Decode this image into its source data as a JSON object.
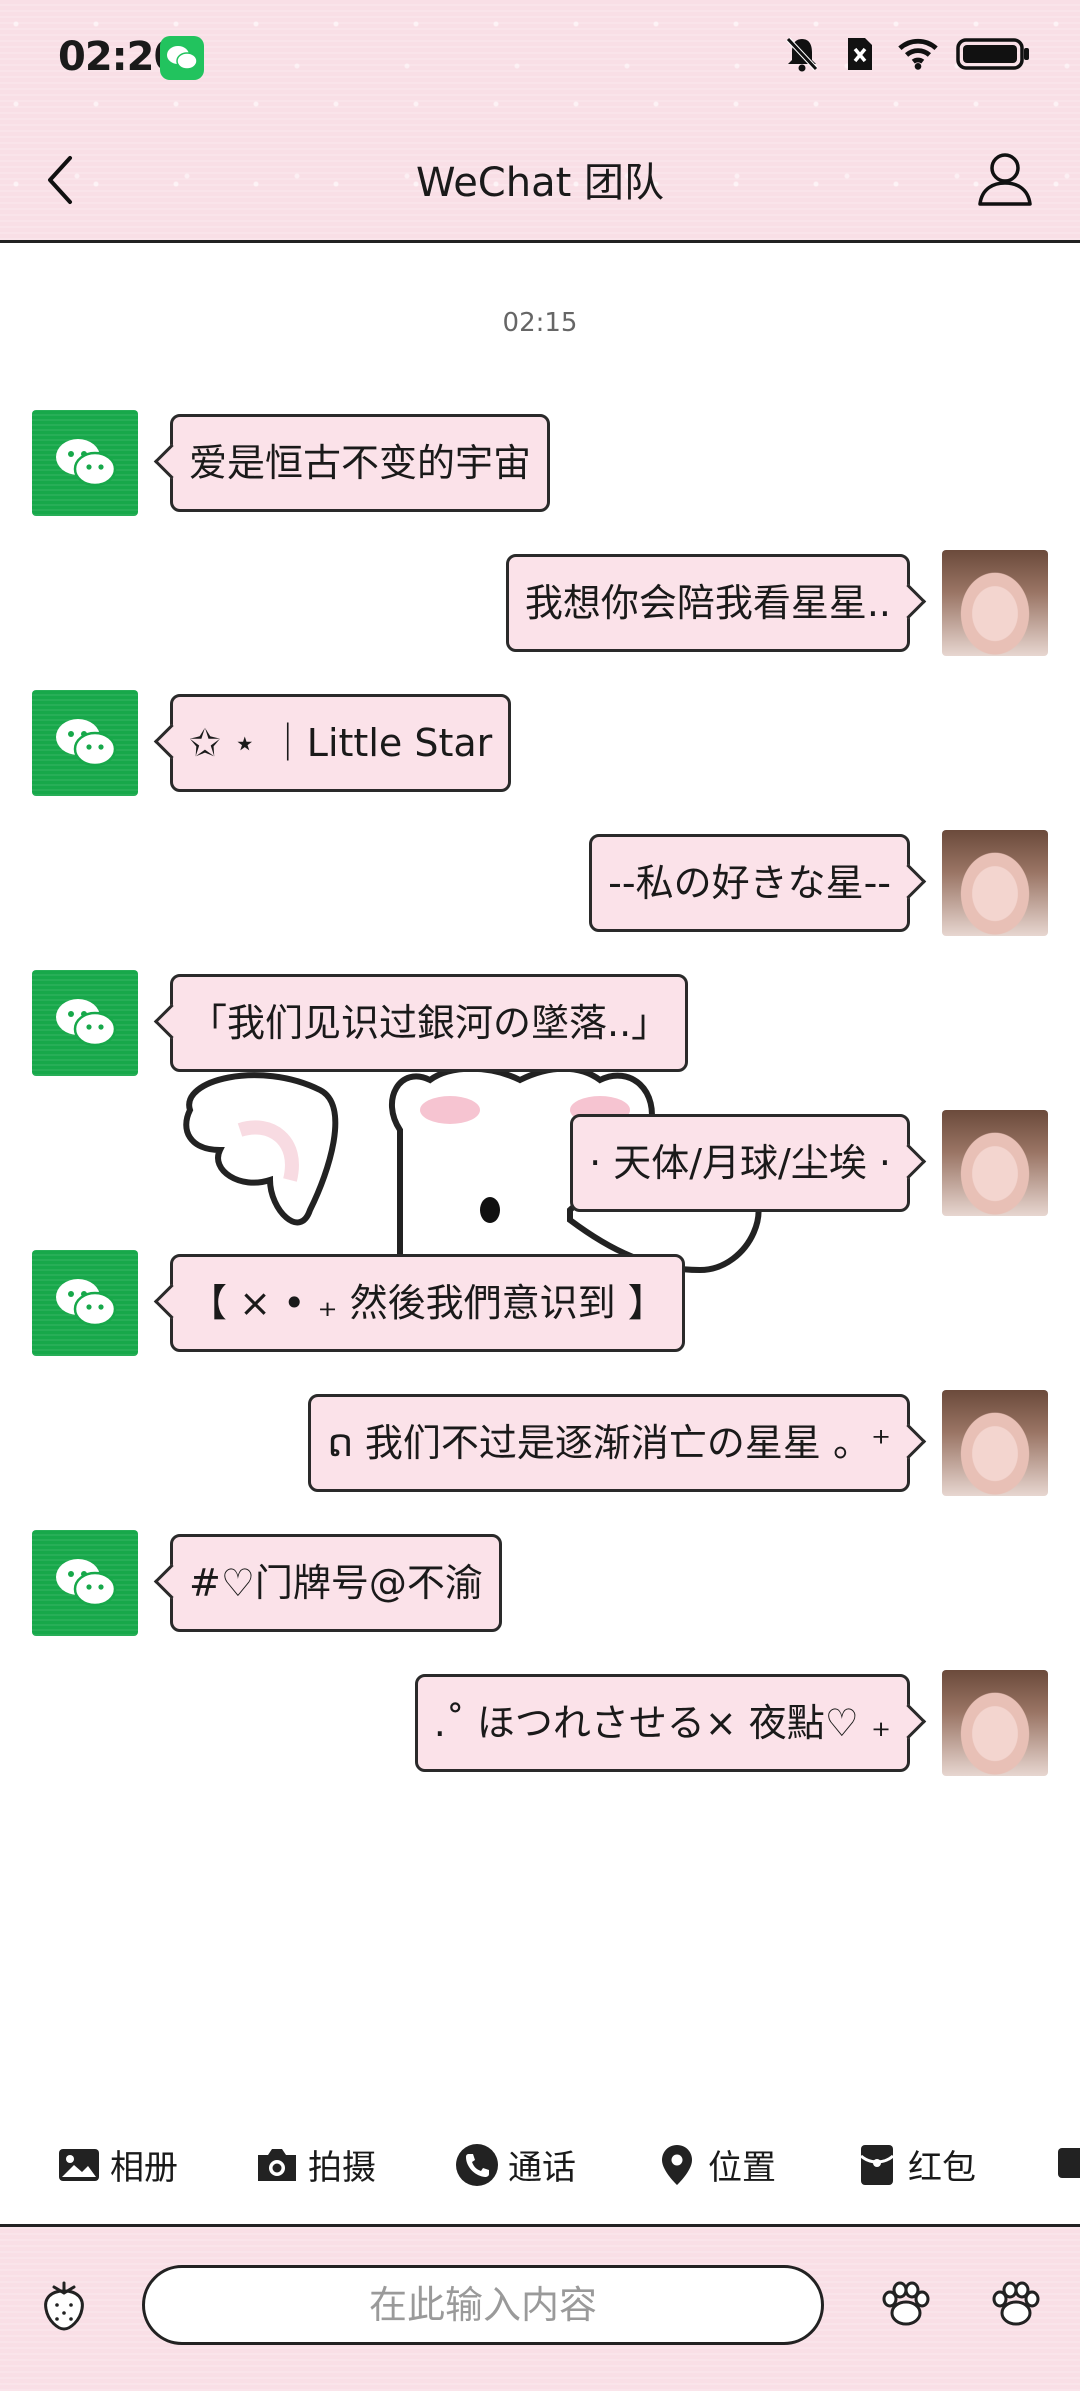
{
  "status_bar": {
    "time": "02:20"
  },
  "header": {
    "title": "WeChat 团队"
  },
  "chat": {
    "timestamp": "02:15",
    "messages": [
      {
        "side": "left",
        "text": "爱是恒古不变的宇宙"
      },
      {
        "side": "right",
        "text": "我想你会陪我看星星.."
      },
      {
        "side": "left",
        "text": "✩ ⋆ ｜Little Star"
      },
      {
        "side": "right",
        "text": "--私の好きな星--"
      },
      {
        "side": "left",
        "text": "「我们见识过銀河の墜落..」"
      },
      {
        "side": "right",
        "text": "· 天体/月球/尘埃 ·"
      },
      {
        "side": "left",
        "text": "【 ⨯ • ₊ 然後我們意识到 】"
      },
      {
        "side": "right",
        "text": "ດ 我们不过是逐渐消亡の星星 。⁺"
      },
      {
        "side": "left",
        "text": "#♡门牌号@不渝"
      },
      {
        "side": "right",
        "text": ".˚ ほつれさせる× 夜點♡ ₊"
      }
    ]
  },
  "toolbar": {
    "items": [
      {
        "label": "相册",
        "icon": "photo-album-icon"
      },
      {
        "label": "拍摄",
        "icon": "camera-icon"
      },
      {
        "label": "通话",
        "icon": "phone-icon"
      },
      {
        "label": "位置",
        "icon": "location-pin-icon"
      },
      {
        "label": "红包",
        "icon": "red-packet-icon"
      }
    ]
  },
  "input": {
    "placeholder": "在此输入内容"
  },
  "colors": {
    "header_bg": "#f9dfe6",
    "bubble_bg": "#fbe2e9",
    "wechat_green": "#17a84a"
  }
}
